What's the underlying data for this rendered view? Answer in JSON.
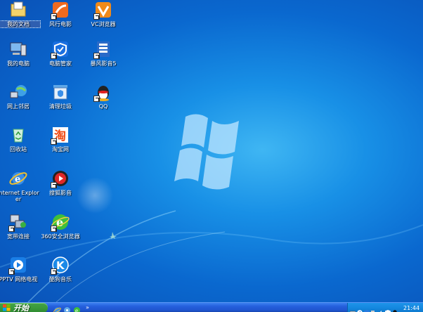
{
  "desktop_icons": [
    {
      "label": "我的文档",
      "icon": "folder-documents-icon"
    },
    {
      "label": "风行电影",
      "icon": "funshion-icon"
    },
    {
      "label": "VC浏览器",
      "icon": "vc-browser-icon"
    },
    {
      "label": "我的电脑",
      "icon": "computer-icon"
    },
    {
      "label": "电脑管家",
      "icon": "pc-manager-icon"
    },
    {
      "label": "暴风影音5",
      "icon": "baofeng-icon"
    },
    {
      "label": "网上邻居",
      "icon": "network-icon"
    },
    {
      "label": "清理垃圾",
      "icon": "clean-trash-icon"
    },
    {
      "label": "QQ",
      "icon": "qq-icon"
    },
    {
      "label": "回收站",
      "icon": "recycle-bin-icon"
    },
    {
      "label": "淘宝网",
      "icon": "taobao-icon"
    },
    {
      "label": "Internet Explorer",
      "icon": "ie-icon"
    },
    {
      "label": "搜狐影音",
      "icon": "sohu-video-icon"
    },
    {
      "label": "宽带连接",
      "icon": "broadband-icon"
    },
    {
      "label": "360安全浏览器",
      "icon": "360-browser-icon"
    },
    {
      "label": "PPTV 网络电视",
      "icon": "pptv-icon"
    },
    {
      "label": "酷狗音乐",
      "icon": "kugou-icon"
    }
  ],
  "taskbar": {
    "start_label": "开始",
    "quick_launch_more": "»",
    "clock": "21:44"
  },
  "colors": {
    "desktop_bg": "#0a68cf",
    "taskbar": "#245edc",
    "start_button": "#3a9a3c"
  }
}
